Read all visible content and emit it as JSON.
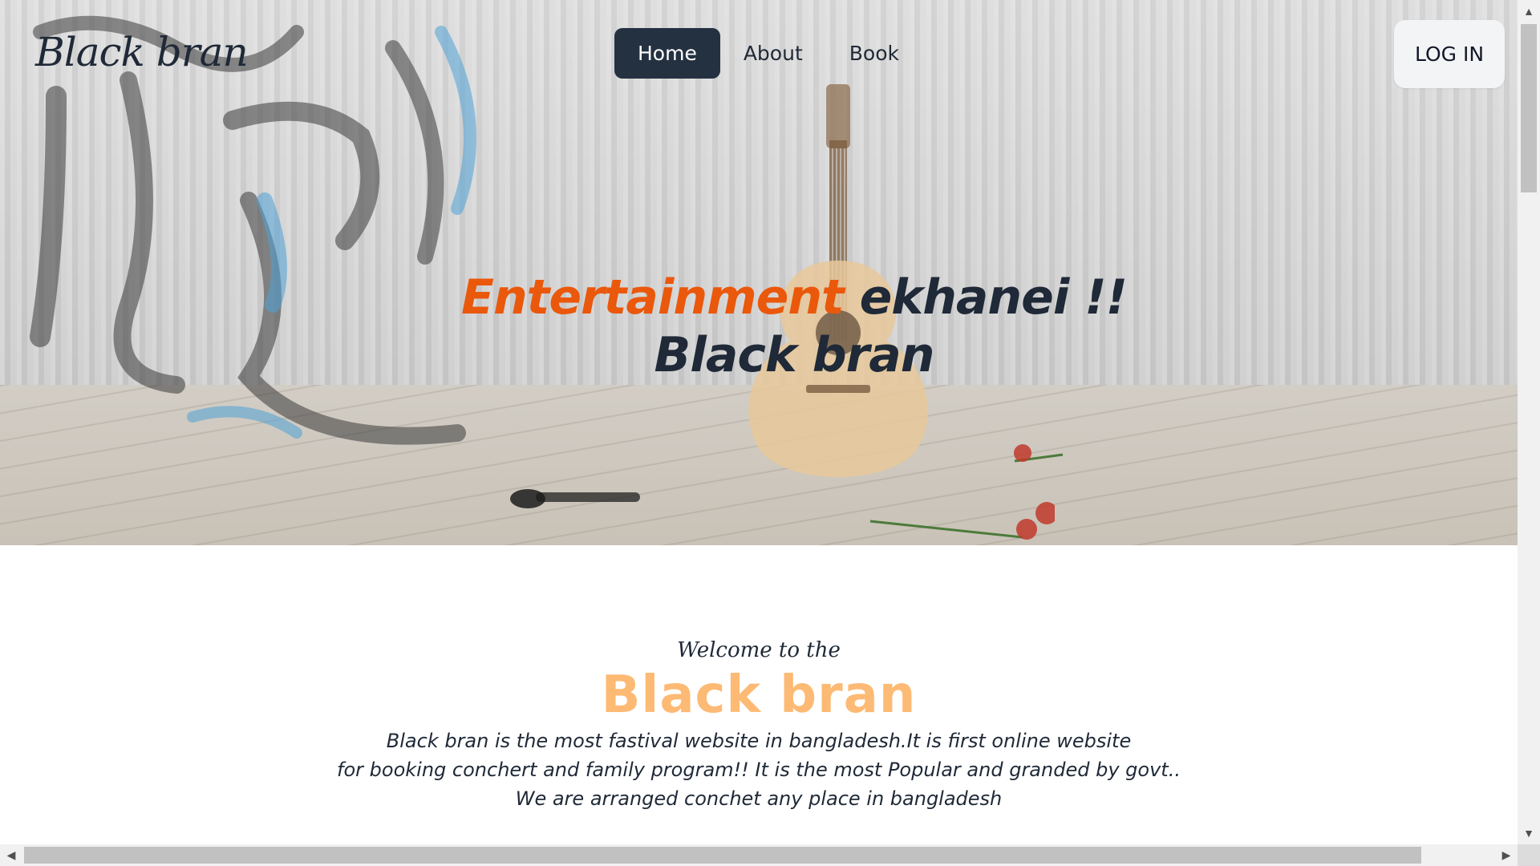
{
  "brand": {
    "name": "Black bran"
  },
  "nav": {
    "items": [
      {
        "label": "Home",
        "active": true
      },
      {
        "label": "About",
        "active": false
      },
      {
        "label": "Book",
        "active": false
      }
    ],
    "login_label": "LOG IN"
  },
  "hero": {
    "headline_accent": "Entertainment",
    "headline_rest": "ekhanei !!",
    "headline_line2": "Black bran"
  },
  "welcome": {
    "small": "Welcome to the",
    "title": "Black bran",
    "description_line1": "Black bran is the most fastival website in bangladesh.It is first online website",
    "description_line2": "for booking conchert and family program!! It is the most Popular and granded by govt.. We are arranged conchet any place in bangladesh"
  },
  "colors": {
    "accent": "#ea580c",
    "dark": "#1f2937",
    "active_nav_bg": "#243141",
    "welcome_title": "#fdba74",
    "login_bg": "#f3f4f6"
  },
  "icons": {
    "scroll_up": "triangle-up-icon",
    "scroll_down": "triangle-down-icon",
    "scroll_left": "triangle-left-icon",
    "scroll_right": "triangle-right-icon"
  }
}
